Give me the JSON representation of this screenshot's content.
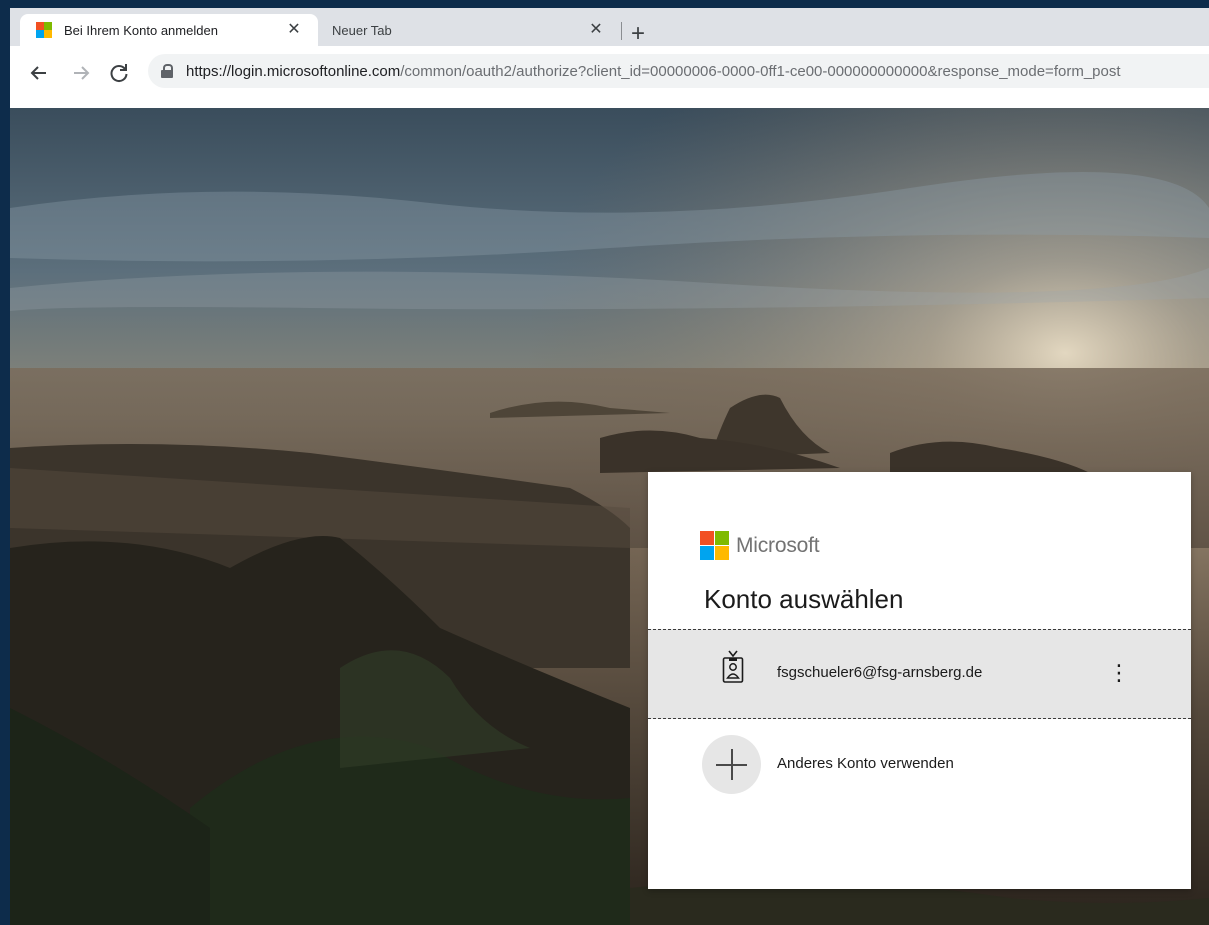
{
  "browser": {
    "tabs": [
      {
        "title": "Bei Ihrem Konto anmelden",
        "close": "✕",
        "active": true
      },
      {
        "title": "Neuer Tab",
        "close": "✕",
        "active": false
      }
    ],
    "new_tab": "+",
    "url_host": "https://login.microsoftonline.com",
    "url_rest": "/common/oauth2/authorize?client_id=00000006-0000-0ff1-ce00-000000000000&response_mode=form_post",
    "icons": {
      "back": "back-arrow-icon",
      "forward": "forward-arrow-icon",
      "reload": "reload-icon",
      "lock": "lock-icon"
    }
  },
  "login": {
    "brand": "Microsoft",
    "title": "Konto auswählen",
    "account_email": "fsgschueler6@fsg-arnsberg.de",
    "more": "⋮",
    "other_account": "Anderes Konto verwenden"
  },
  "colors": {
    "ms_red": "#f25022",
    "ms_green": "#7fba00",
    "ms_blue": "#00a4ef",
    "ms_yellow": "#ffb900",
    "selected_row": "#e6e6e6"
  }
}
